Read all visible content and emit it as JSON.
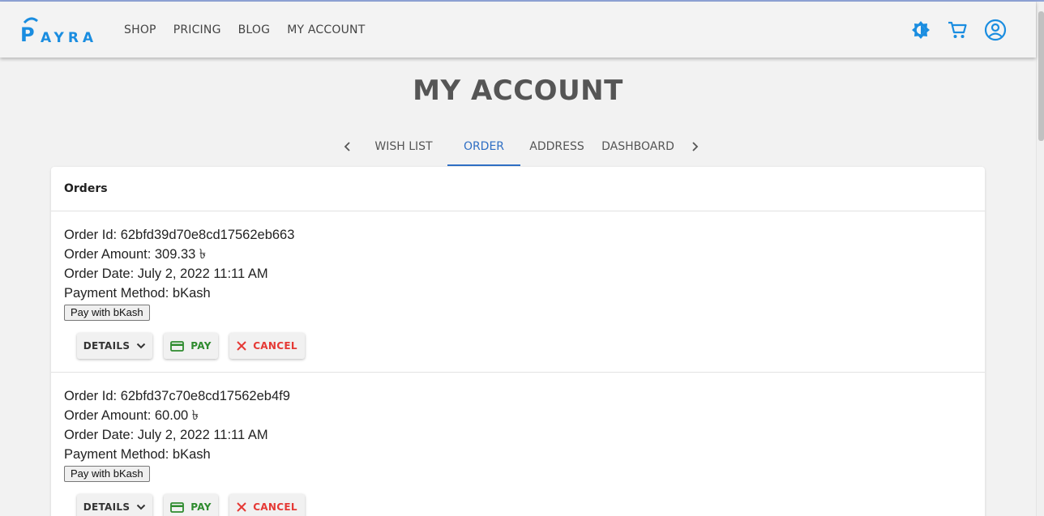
{
  "brand": {
    "logo_text": "PAYRA",
    "logo_color": "#1a8de0"
  },
  "nav": {
    "items": [
      "SHOP",
      "PRICING",
      "BLOG",
      "MY ACCOUNT"
    ]
  },
  "header_icons": [
    "brightness-icon",
    "cart-icon",
    "account-icon"
  ],
  "page_title": "MY ACCOUNT",
  "tabs": {
    "items": [
      "WISH LIST",
      "ORDER",
      "ADDRESS",
      "DASHBOARD"
    ],
    "active": "ORDER",
    "accent": "#2f6fc4"
  },
  "orders_card": {
    "title": "Orders",
    "orders": [
      {
        "id_line": "Order Id: 62bfd39d70e8cd17562eb663",
        "amount_line": "Order Amount: 309.33 ৳",
        "date_line": "Order Date: July 2, 2022 11:11 AM",
        "method_line": "Payment Method: bKash",
        "pay_with_label": "Pay with bKash"
      },
      {
        "id_line": "Order Id: 62bfd37c70e8cd17562eb4f9",
        "amount_line": "Order Amount: 60.00 ৳",
        "date_line": "Order Date: July 2, 2022 11:11 AM",
        "method_line": "Payment Method: bKash",
        "pay_with_label": "Pay with bKash"
      }
    ],
    "actions": {
      "details": "DETAILS",
      "pay": "PAY",
      "cancel": "CANCEL"
    },
    "colors": {
      "pay": "#2e8b2e",
      "cancel": "#e53935"
    }
  }
}
